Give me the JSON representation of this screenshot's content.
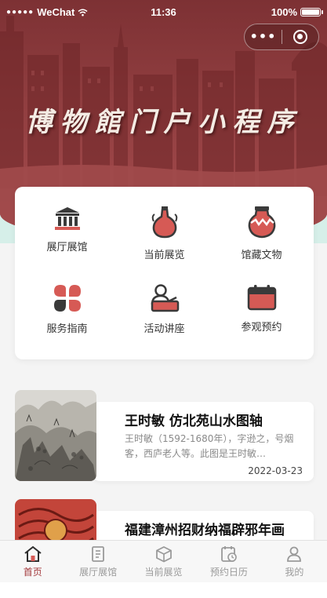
{
  "status_bar": {
    "carrier": "WeChat",
    "time": "11:36",
    "battery": "100%"
  },
  "hero": {
    "title": "博物館门户小程序"
  },
  "menu": [
    {
      "label": "展厅展馆",
      "icon": "museum-building-icon"
    },
    {
      "label": "当前展览",
      "icon": "vase-icon"
    },
    {
      "label": "馆藏文物",
      "icon": "pottery-jar-icon"
    },
    {
      "label": "服务指南",
      "icon": "clover-icon"
    },
    {
      "label": "活动讲座",
      "icon": "lecture-podium-icon"
    },
    {
      "label": "参观预约",
      "icon": "calendar-icon"
    }
  ],
  "exhibits": [
    {
      "title": "王时敏 仿北苑山水图轴",
      "desc": "王时敏（1592-1680年），字逊之，号烟客，西庐老人等。此图是王时敏…",
      "date": "2022-03-23"
    },
    {
      "title": "福建漳州招财纳福辟邪年画",
      "desc": "",
      "date": ""
    }
  ],
  "tabbar": [
    {
      "label": "首页",
      "icon": "home-icon",
      "active": true
    },
    {
      "label": "展厅展馆",
      "icon": "hall-icon",
      "active": false
    },
    {
      "label": "当前展览",
      "icon": "box-icon",
      "active": false
    },
    {
      "label": "预约日历",
      "icon": "calendar-clock-icon",
      "active": false
    },
    {
      "label": "我的",
      "icon": "user-icon",
      "active": false
    }
  ],
  "colors": {
    "brand": "#a3393c",
    "hero": "#8f3d3f",
    "mint": "#d6efe9",
    "icon_dark": "#3a3a3a",
    "icon_red": "#d65a55"
  }
}
